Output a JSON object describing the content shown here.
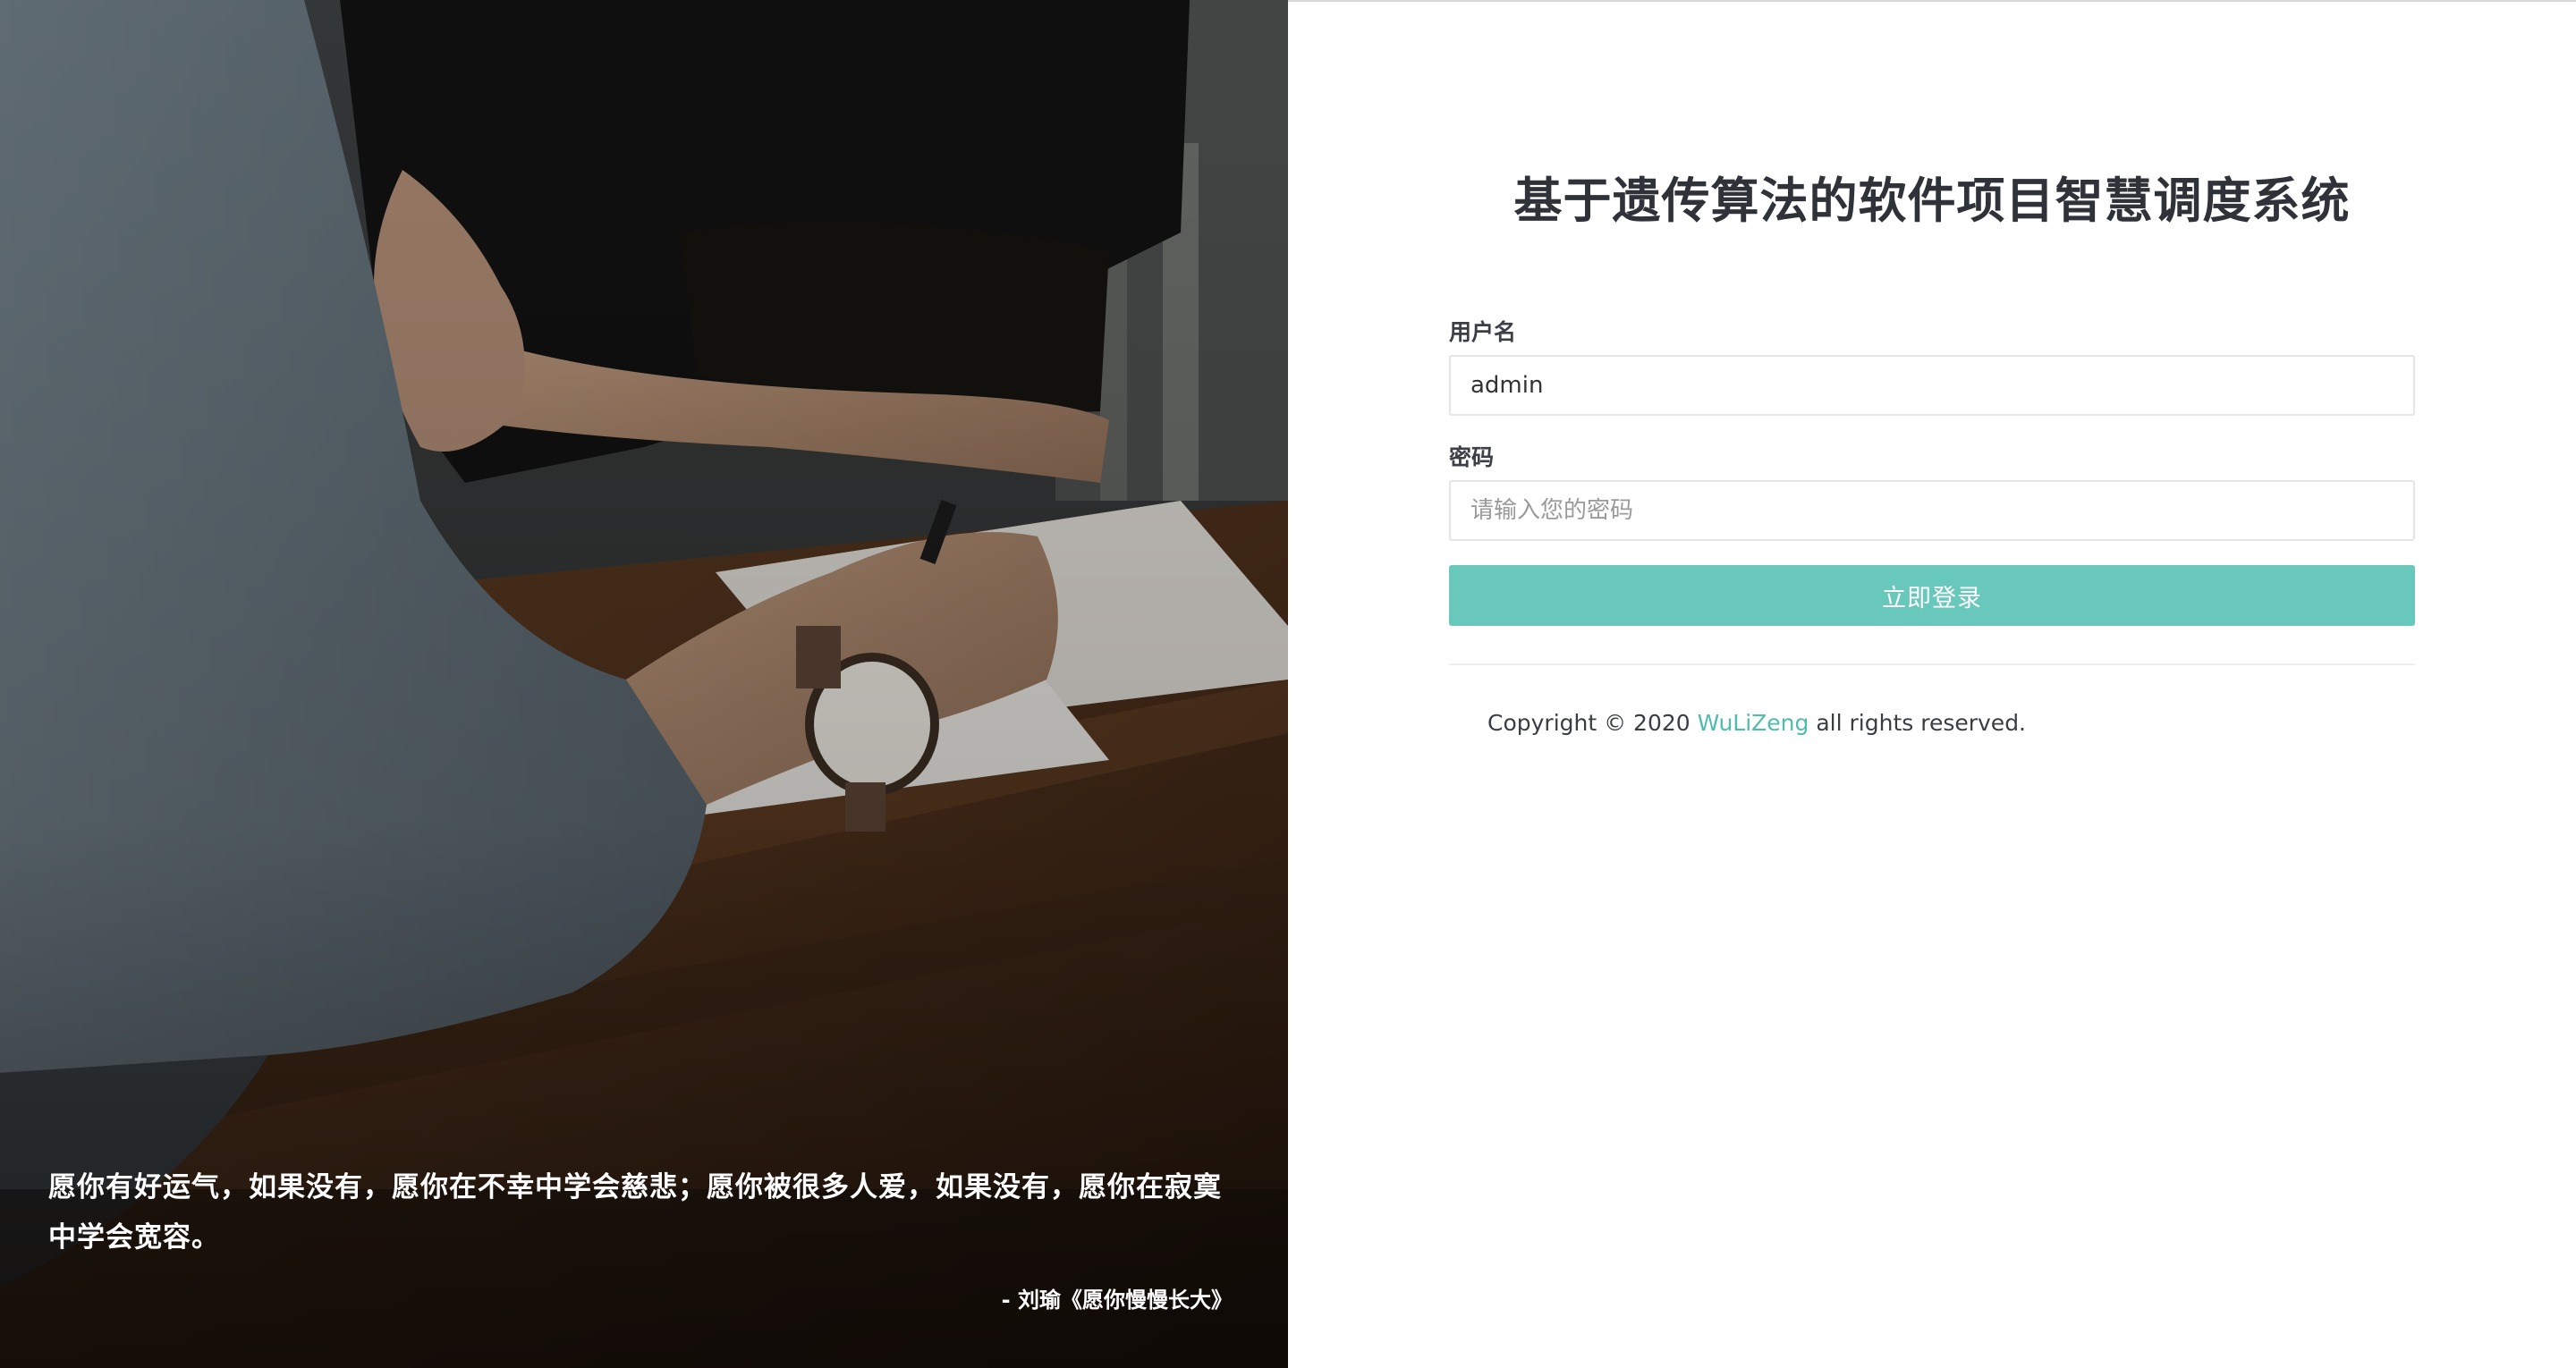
{
  "app": {
    "title": "基于遗传算法的软件项目智慧调度系统"
  },
  "login_form": {
    "username_label": "用户名",
    "username_value": "admin",
    "password_label": "密码",
    "password_placeholder": "请输入您的密码",
    "submit_label": "立即登录"
  },
  "footer": {
    "copyright_prefix": "Copyright © 2020 ",
    "author_link": "WuLiZeng",
    "copyright_suffix": " all rights reserved."
  },
  "quote": {
    "text": "愿你有好运气，如果没有，愿你在不幸中学会慈悲；愿你被很多人爱，如果没有，愿你在寂寞中学会宽容。",
    "author": "- 刘瑜《愿你慢慢长大》"
  },
  "colors": {
    "accent": "#68c8bb",
    "link": "#4fbcae",
    "title_text": "#2f3238"
  }
}
